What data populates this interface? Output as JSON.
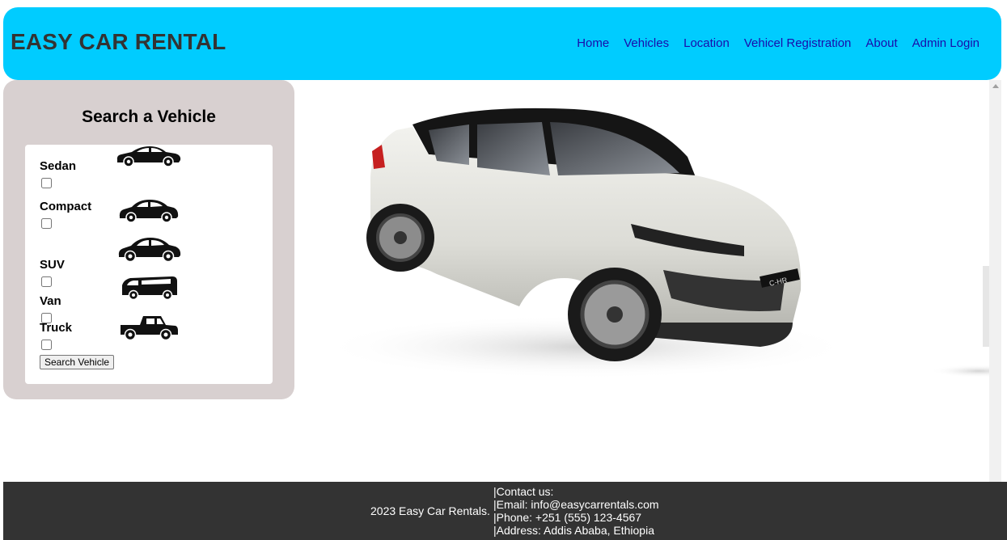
{
  "header": {
    "brand": "EASY CAR RENTAL",
    "nav": [
      "Home",
      "Vehicles",
      "Location",
      "Vehicel Registration",
      "About",
      "Admin Login"
    ]
  },
  "search": {
    "title": "Search a Vehicle",
    "types": [
      {
        "label": "Sedan",
        "icon": "sedan-icon",
        "checked": false
      },
      {
        "label": "Compact",
        "icon": "compact-car-icon",
        "checked": false
      },
      {
        "label": "SUV",
        "icon": "suv-icon",
        "checked": false
      },
      {
        "label": "Van",
        "icon": "van-icon",
        "checked": false
      },
      {
        "label": "Truck",
        "icon": "pickup-truck-icon",
        "checked": false
      }
    ],
    "button_label": "Search Vehicle"
  },
  "hero": {
    "image": "white-toyota-chr-suv",
    "badge_text": "C-HR"
  },
  "footer": {
    "copyright": "2023 Easy Car Rentals.",
    "contact": [
      "|Contact us:",
      "|Email: info@easycarrentals.com",
      "|Phone: +251 (555) 123-4567",
      "|Address: Addis Ababa, Ethiopia"
    ]
  },
  "colors": {
    "header_bg": "#00ccff",
    "sidebar_bg": "#d8d0d0",
    "footer_bg": "#333333",
    "nav_link": "#1a0dab"
  }
}
